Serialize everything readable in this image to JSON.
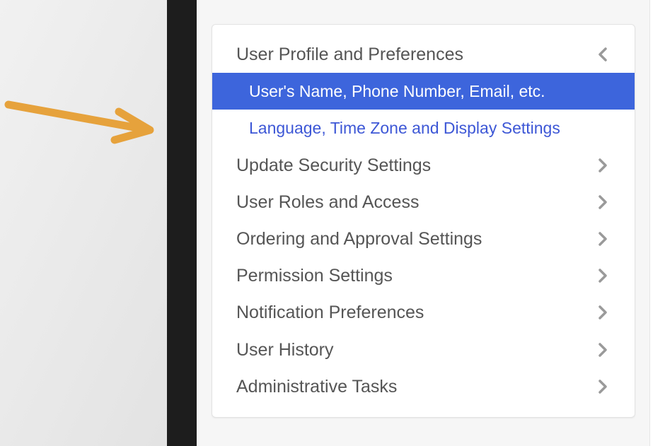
{
  "colors": {
    "background": "#e4e4e4",
    "dark_bar": "#1d1d1d",
    "active_bg": "#3d65dc",
    "link_text": "#3d57d6",
    "menu_text": "#555555",
    "annotation_arrow": "#e6a23c"
  },
  "menu": {
    "items": [
      {
        "label": "User Profile and Preferences",
        "icon": "chevron-left-icon",
        "expanded": true,
        "subitems": [
          {
            "label": "User's Name, Phone Number, Email, etc.",
            "active": true
          },
          {
            "label": "Language, Time Zone and Display Settings",
            "active": false
          }
        ]
      },
      {
        "label": "Update Security Settings",
        "icon": "chevron-right-icon"
      },
      {
        "label": "User Roles and Access",
        "icon": "chevron-right-icon"
      },
      {
        "label": "Ordering and Approval Settings",
        "icon": "chevron-right-icon"
      },
      {
        "label": "Permission Settings",
        "icon": "chevron-right-icon"
      },
      {
        "label": "Notification Preferences",
        "icon": "chevron-right-icon"
      },
      {
        "label": "User History",
        "icon": "chevron-right-icon"
      },
      {
        "label": "Administrative Tasks",
        "icon": "chevron-right-icon"
      }
    ]
  }
}
